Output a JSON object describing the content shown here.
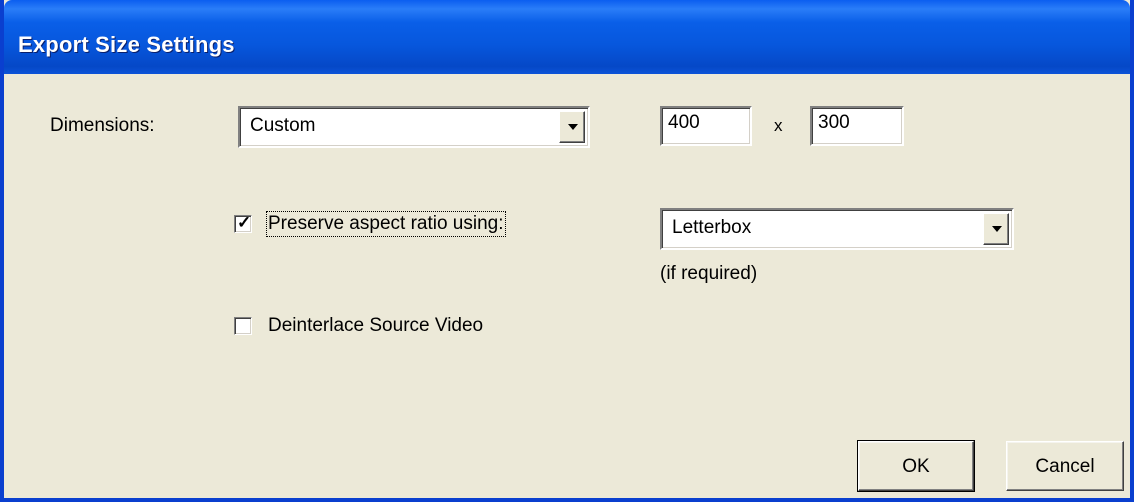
{
  "window": {
    "title": "Export Size Settings"
  },
  "dimensions": {
    "label": "Dimensions:",
    "preset": "Custom",
    "width": "400",
    "separator": "x",
    "height": "300"
  },
  "preserve": {
    "label": "Preserve aspect ratio using:",
    "checked": true,
    "method": "Letterbox",
    "note": "(if required)"
  },
  "deinterlace": {
    "label": "Deinterlace Source Video",
    "checked": false
  },
  "buttons": {
    "ok": "OK",
    "cancel": "Cancel"
  }
}
